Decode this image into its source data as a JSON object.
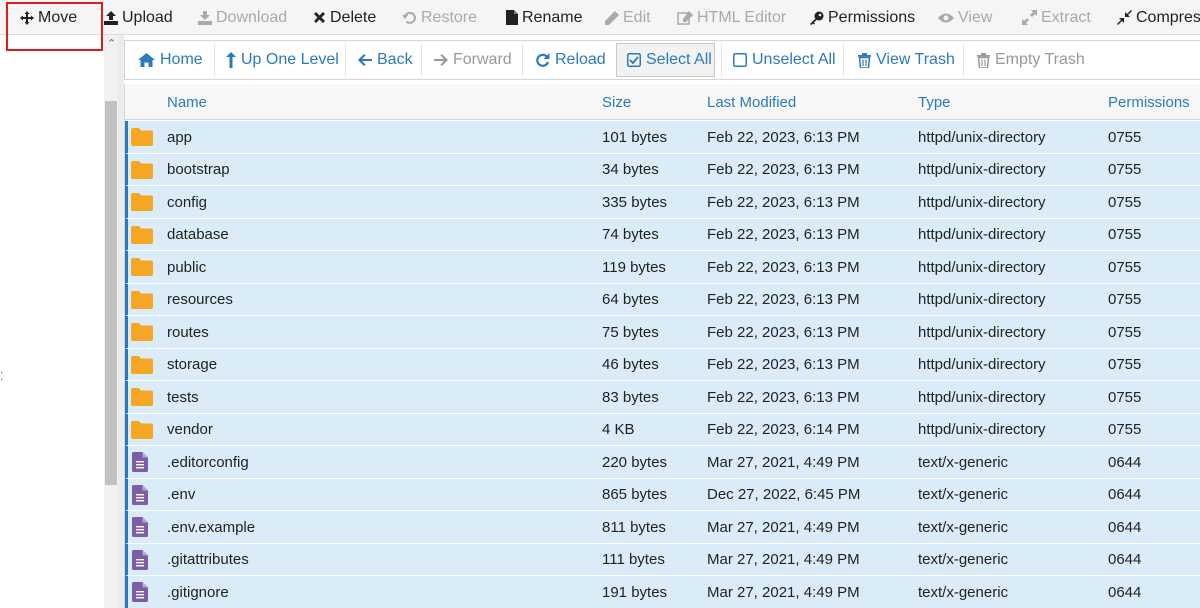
{
  "toolbar": {
    "items": [
      {
        "label": "Move",
        "icon": "move-icon",
        "enabled": true
      },
      {
        "label": "Upload",
        "icon": "upload-icon",
        "enabled": true
      },
      {
        "label": "Download",
        "icon": "download-icon",
        "enabled": false
      },
      {
        "label": "Delete",
        "icon": "delete-icon",
        "enabled": true
      },
      {
        "label": "Restore",
        "icon": "restore-icon",
        "enabled": false
      },
      {
        "label": "Rename",
        "icon": "rename-icon",
        "enabled": true
      },
      {
        "label": "Edit",
        "icon": "edit-icon",
        "enabled": false
      },
      {
        "label": "HTML Editor",
        "icon": "html-editor-icon",
        "enabled": false
      },
      {
        "label": "Permissions",
        "icon": "permissions-icon",
        "enabled": true
      },
      {
        "label": "View",
        "icon": "view-icon",
        "enabled": false
      },
      {
        "label": "Extract",
        "icon": "extract-icon",
        "enabled": false
      },
      {
        "label": "Compress",
        "icon": "compress-icon",
        "enabled": true
      }
    ]
  },
  "navbar": {
    "items": [
      {
        "label": "Home",
        "icon": "home-icon",
        "enabled": true
      },
      {
        "label": "Up One Level",
        "icon": "up-level-icon",
        "enabled": true
      },
      {
        "label": "Back",
        "icon": "back-arrow-icon",
        "enabled": true
      },
      {
        "label": "Forward",
        "icon": "forward-arrow-icon",
        "enabled": false
      },
      {
        "label": "Reload",
        "icon": "reload-icon",
        "enabled": true
      },
      {
        "label": "Select All",
        "icon": "checkbox-checked-icon",
        "enabled": true,
        "active": true
      },
      {
        "label": "Unselect All",
        "icon": "checkbox-empty-icon",
        "enabled": true
      },
      {
        "label": "View Trash",
        "icon": "trash-icon",
        "enabled": true
      },
      {
        "label": "Empty Trash",
        "icon": "trash-icon",
        "enabled": false
      }
    ]
  },
  "table": {
    "headers": {
      "name": "Name",
      "size": "Size",
      "modified": "Last Modified",
      "type": "Type",
      "permissions": "Permissions"
    },
    "rows": [
      {
        "name": "app",
        "kind": "folder",
        "size": "101 bytes",
        "modified": "Feb 22, 2023, 6:13 PM",
        "type": "httpd/unix-directory",
        "perm": "0755"
      },
      {
        "name": "bootstrap",
        "kind": "folder",
        "size": "34 bytes",
        "modified": "Feb 22, 2023, 6:13 PM",
        "type": "httpd/unix-directory",
        "perm": "0755"
      },
      {
        "name": "config",
        "kind": "folder",
        "size": "335 bytes",
        "modified": "Feb 22, 2023, 6:13 PM",
        "type": "httpd/unix-directory",
        "perm": "0755"
      },
      {
        "name": "database",
        "kind": "folder",
        "size": "74 bytes",
        "modified": "Feb 22, 2023, 6:13 PM",
        "type": "httpd/unix-directory",
        "perm": "0755"
      },
      {
        "name": "public",
        "kind": "folder",
        "size": "119 bytes",
        "modified": "Feb 22, 2023, 6:13 PM",
        "type": "httpd/unix-directory",
        "perm": "0755"
      },
      {
        "name": "resources",
        "kind": "folder",
        "size": "64 bytes",
        "modified": "Feb 22, 2023, 6:13 PM",
        "type": "httpd/unix-directory",
        "perm": "0755"
      },
      {
        "name": "routes",
        "kind": "folder",
        "size": "75 bytes",
        "modified": "Feb 22, 2023, 6:13 PM",
        "type": "httpd/unix-directory",
        "perm": "0755"
      },
      {
        "name": "storage",
        "kind": "folder",
        "size": "46 bytes",
        "modified": "Feb 22, 2023, 6:13 PM",
        "type": "httpd/unix-directory",
        "perm": "0755"
      },
      {
        "name": "tests",
        "kind": "folder",
        "size": "83 bytes",
        "modified": "Feb 22, 2023, 6:13 PM",
        "type": "httpd/unix-directory",
        "perm": "0755"
      },
      {
        "name": "vendor",
        "kind": "folder",
        "size": "4 KB",
        "modified": "Feb 22, 2023, 6:14 PM",
        "type": "httpd/unix-directory",
        "perm": "0755"
      },
      {
        "name": ".editorconfig",
        "kind": "file",
        "size": "220 bytes",
        "modified": "Mar 27, 2021, 4:49 PM",
        "type": "text/x-generic",
        "perm": "0644"
      },
      {
        "name": ".env",
        "kind": "file",
        "size": "865 bytes",
        "modified": "Dec 27, 2022, 6:45 PM",
        "type": "text/x-generic",
        "perm": "0644"
      },
      {
        "name": ".env.example",
        "kind": "file",
        "size": "811 bytes",
        "modified": "Mar 27, 2021, 4:49 PM",
        "type": "text/x-generic",
        "perm": "0644"
      },
      {
        "name": ".gitattributes",
        "kind": "file",
        "size": "111 bytes",
        "modified": "Mar 27, 2021, 4:49 PM",
        "type": "text/x-generic",
        "perm": "0644"
      },
      {
        "name": ".gitignore",
        "kind": "file",
        "size": "191 bytes",
        "modified": "Mar 27, 2021, 4:49 PM",
        "type": "text/x-generic",
        "perm": "0644"
      }
    ]
  },
  "colors": {
    "accent": "#2a7ac0",
    "row_selected": "#d9ecf7",
    "folder": "#f5a623",
    "file": "#7b5ea7",
    "highlight": "#e01b1b",
    "disabled": "#aaaaaa"
  }
}
